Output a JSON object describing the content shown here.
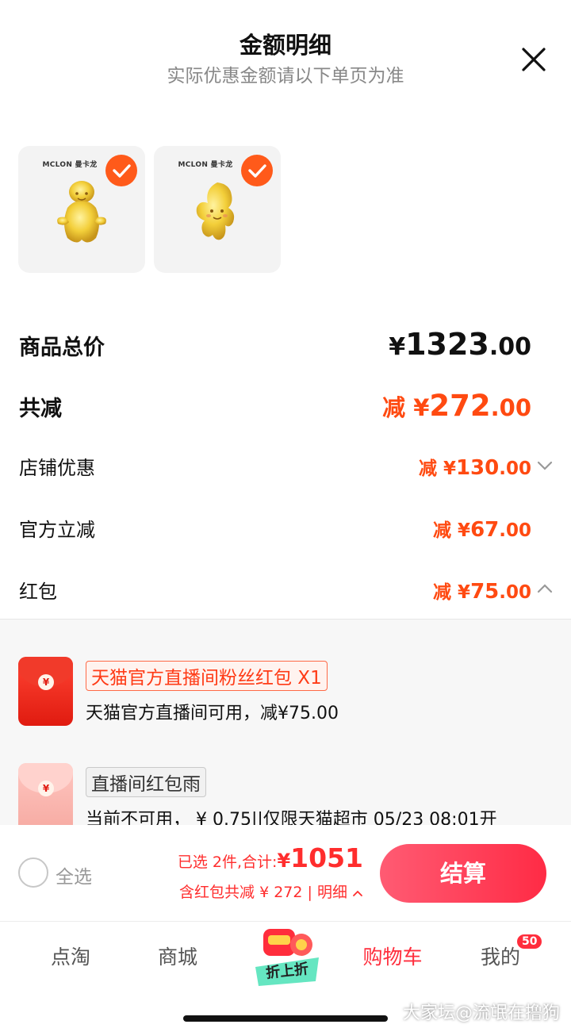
{
  "header": {
    "title": "金额明细",
    "subtitle": "实际优惠金额请以下单页为准"
  },
  "products": [
    {
      "brand": "MCLON 曼卡龙",
      "selected": true
    },
    {
      "brand": "MCLON 曼卡龙",
      "selected": true
    }
  ],
  "summary": {
    "total_label": "商品总价",
    "total_currency": "¥",
    "total_int": "1323",
    "total_dec": ".00",
    "reduce_label": "共减",
    "reduce_prefix": "减 ¥",
    "reduce_int": "272",
    "reduce_dec": ".00"
  },
  "discounts": [
    {
      "label": "店铺优惠",
      "prefix": "减 ¥",
      "int": "130",
      "dec": ".00",
      "chevron": "down"
    },
    {
      "label": "官方立减",
      "prefix": "减 ¥",
      "int": "67",
      "dec": ".00"
    },
    {
      "label": "红包",
      "prefix": "减 ¥",
      "int": "75",
      "dec": ".00",
      "chevron": "up"
    }
  ],
  "packets": [
    {
      "tag": "天猫官方直播间粉丝红包 X1",
      "desc": "天猫官方直播间可用，减¥75.00",
      "style": "active",
      "coin": "¥"
    },
    {
      "tag": "直播间红包雨",
      "desc": "当前不可用， ¥ 0.75||仅限天猫超市 05/23 08:01开",
      "style": "disabled",
      "coin": "¥"
    }
  ],
  "checkout": {
    "select_all": "全选",
    "selected_text": "已选 2件,合计:",
    "currency": "¥",
    "amount": "1051",
    "detail_text": "含红包共减 ¥ 272 | 明细",
    "pay_label": "结算"
  },
  "tabbar": {
    "tabs": [
      "点淘",
      "商城",
      "购物车",
      "我的"
    ],
    "promo_label": "折上折",
    "badge": "50"
  },
  "watermark": "大家坛@流氓在撸狗",
  "colors": {
    "accent": "#ff4a11",
    "primary_red": "#ff2d3c",
    "check_orange": "#ff5a1a"
  }
}
